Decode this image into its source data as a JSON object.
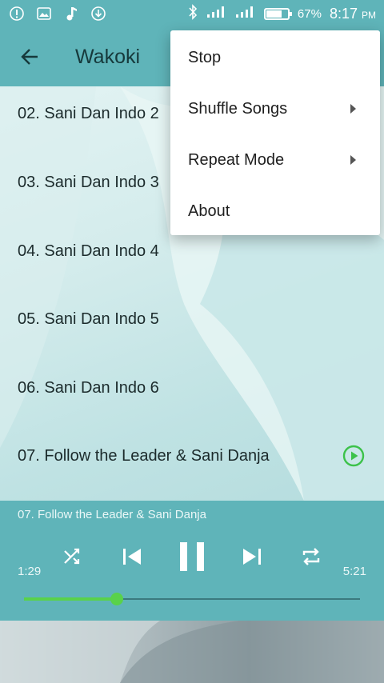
{
  "status_bar": {
    "left_icons": [
      "alert-icon",
      "image-icon",
      "music-note-icon",
      "download-icon"
    ],
    "battery": "67%",
    "time": "8:17",
    "ampm": "PM"
  },
  "toolbar": {
    "title": "Wakoki"
  },
  "songs": [
    {
      "title": "02. Sani Dan Indo 2"
    },
    {
      "title": "03. Sani Dan Indo 3"
    },
    {
      "title": "04. Sani Dan Indo 4"
    },
    {
      "title": "05. Sani Dan Indo 5"
    },
    {
      "title": "06. Sani Dan Indo 6"
    },
    {
      "title": "07. Follow the Leader & Sani Danja"
    }
  ],
  "player": {
    "now_playing": "07. Follow the Leader & Sani Danja",
    "elapsed": "1:29",
    "total": "5:21",
    "progress_fraction": 0.277
  },
  "menu": {
    "items": [
      {
        "label": "Stop",
        "has_submenu": false
      },
      {
        "label": "Shuffle Songs",
        "has_submenu": true
      },
      {
        "label": "Repeat Mode",
        "has_submenu": true
      },
      {
        "label": "About",
        "has_submenu": false
      }
    ]
  },
  "colors": {
    "accent": "#5fb4b9",
    "progress": "#59d24a"
  }
}
